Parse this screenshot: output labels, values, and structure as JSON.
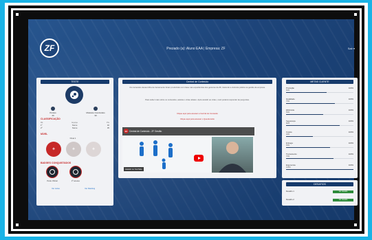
{
  "header": {
    "welcome": "Prezado (a): Aluno EAA | Empresa: ZF",
    "user_menu": "Sair",
    "logo": "ZF"
  },
  "left": {
    "title": "TESTE",
    "stats": [
      {
        "label": "Pontos",
        "value": "40"
      },
      {
        "label": "Módulos Concluídos",
        "value": "30"
      }
    ],
    "classification_title": "CLASSIFICAÇÃO",
    "ranking_headers": [
      "Rk",
      "Equipe",
      "Pts"
    ],
    "ranking": [
      [
        "1º",
        "Nome",
        "40"
      ],
      [
        "2º",
        "Nome",
        "35"
      ]
    ],
    "level_title": "NÍVEL",
    "level_label": "Nível 1",
    "badges_title": "BADGES CONQUISTADOS",
    "badges": [
      {
        "label": "Parte Oficial"
      },
      {
        "label": "1ª acesso"
      }
    ],
    "links": [
      "Ver todos",
      "Ver Ranking"
    ]
  },
  "mid": {
    "title": "Central de Conteúdo",
    "paragraph1": "Os conteúdos dessa trilha de treinamento foram produzidos com base nas experiências dos gestores da ZF, trazendo a vivência prática na gestão da empresa.",
    "paragraph2": "Para saber mais sobre os conteúdos, assista o vídeo abaixo. Após assistir ao vídeo, você poderá responder às perguntas.",
    "link1": "Clique aqui para acessar a Central de Conteúdo",
    "link2": "Clique aqui para acessar o Questionário",
    "video_title": "Central de Conteúdo - ZF Gestão",
    "video_watch": "Assistir no YouTube",
    "video_badge": "ZF"
  },
  "right": {
    "title": "METAS CLIENTE",
    "metrics": [
      {
        "name": "Produção",
        "right": "100%",
        "pct": "60%",
        "fill": 0.6
      },
      {
        "name": "Qualidade",
        "right": "100%",
        "pct": "72%",
        "fill": 0.72
      },
      {
        "name": "Eficiência",
        "right": "100%",
        "pct": "55%",
        "fill": 0.55
      },
      {
        "name": "Segurança",
        "right": "100%",
        "pct": "80%",
        "fill": 0.8
      },
      {
        "name": "Custos",
        "right": "100%",
        "pct": "40%",
        "fill": 0.4
      },
      {
        "name": "Entrega",
        "right": "100%",
        "pct": "65%",
        "fill": 0.65
      },
      {
        "name": "Treinamento",
        "right": "100%",
        "pct": "70%",
        "fill": 0.7
      },
      {
        "name": "Ergonomia",
        "right": "100%",
        "pct": "100%",
        "fill": 1.0
      }
    ]
  },
  "bottom_right": {
    "title": "DESAFIOS",
    "rows": [
      {
        "label": "Desafio 1",
        "btn": "Ver desafio"
      },
      {
        "label": "Desafio 2",
        "btn": "Ver desafio"
      }
    ]
  }
}
